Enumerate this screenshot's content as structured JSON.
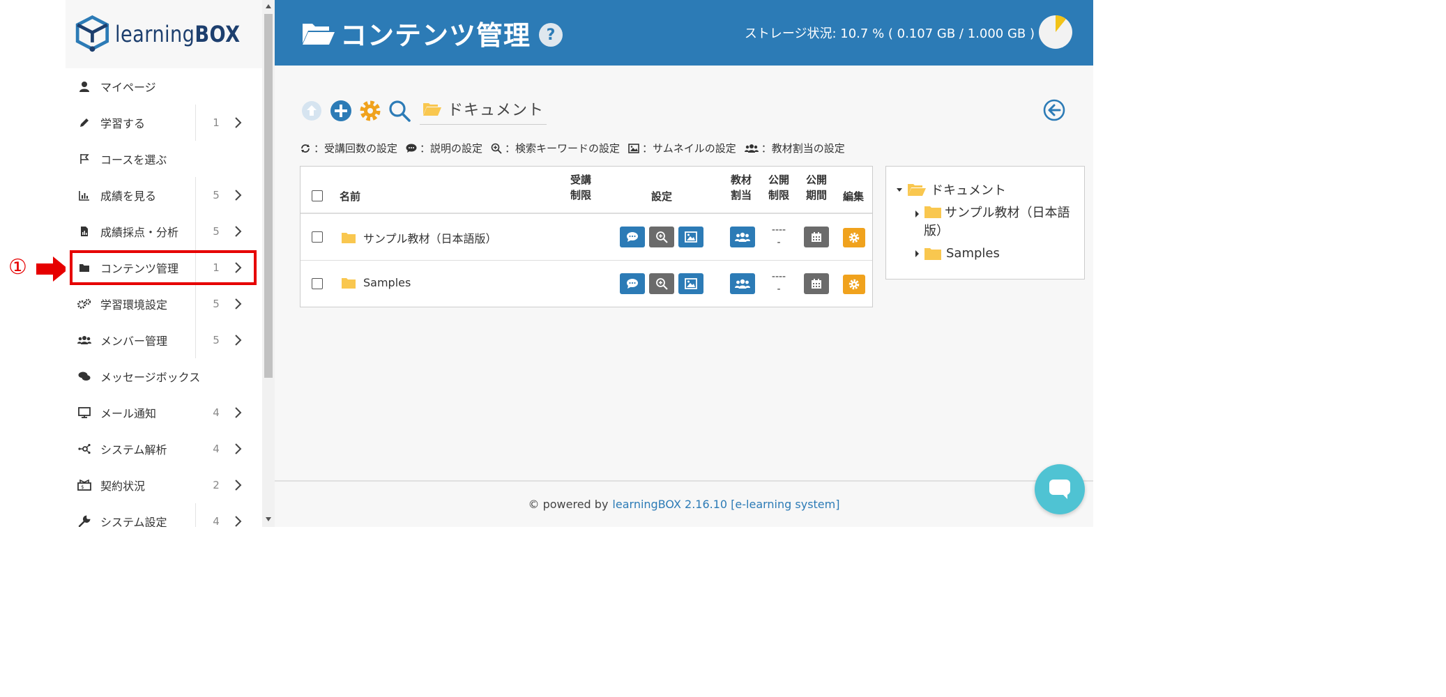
{
  "callout": {
    "number": "①"
  },
  "logo": {
    "brand_light": "learning",
    "brand_bold": "BOX"
  },
  "sidebar": {
    "items": [
      {
        "label": "マイページ",
        "icon": "user-icon",
        "count": "",
        "has_chevron": false
      },
      {
        "label": "学習する",
        "icon": "pencil-icon",
        "count": "1",
        "has_chevron": true
      },
      {
        "label": "コースを選ぶ",
        "icon": "flag-icon",
        "count": "",
        "has_chevron": false
      },
      {
        "label": "成績を見る",
        "icon": "bar-chart-icon",
        "count": "5",
        "has_chevron": true
      },
      {
        "label": "成績採点・分析",
        "icon": "report-icon",
        "count": "5",
        "has_chevron": true
      },
      {
        "label": "コンテンツ管理",
        "icon": "folder-icon",
        "count": "1",
        "has_chevron": true,
        "selected": true
      },
      {
        "label": "学習環境設定",
        "icon": "gears-icon",
        "count": "5",
        "has_chevron": true
      },
      {
        "label": "メンバー管理",
        "icon": "users-icon",
        "count": "5",
        "has_chevron": true
      },
      {
        "label": "メッセージボックス",
        "icon": "comments-icon",
        "count": "",
        "has_chevron": false
      },
      {
        "label": "メール通知",
        "icon": "monitor-icon",
        "count": "4",
        "has_chevron": true
      },
      {
        "label": "システム解析",
        "icon": "network-icon",
        "count": "4",
        "has_chevron": true
      },
      {
        "label": "契約状況",
        "icon": "contract-icon",
        "count": "2",
        "has_chevron": true
      },
      {
        "label": "システム設定",
        "icon": "wrench-icon",
        "count": "4",
        "has_chevron": true
      }
    ]
  },
  "header": {
    "title": "コンテンツ管理",
    "help": "?",
    "storage": "ストレージ状況: 10.7 % ( 0.107 GB / 1.000 GB )",
    "storage_percent": 10.7
  },
  "toolbar": {
    "breadcrumb": "ドキュメント"
  },
  "legend": [
    {
      "icon": "repeat-icon",
      "label": "：受講回数の設定"
    },
    {
      "icon": "comment-icon",
      "label": "：説明の設定"
    },
    {
      "icon": "search-plus-icon",
      "label": "：検索キーワードの設定"
    },
    {
      "icon": "image-icon",
      "label": "：サムネイルの設定"
    },
    {
      "icon": "users-icon",
      "label": "：教材割当の設定"
    }
  ],
  "table": {
    "headers": {
      "name": "名前",
      "limit_1": "受講",
      "limit_2": "制限",
      "settings": "設定",
      "assign_1": "教材",
      "assign_2": "割当",
      "pub_limit_1": "公開",
      "pub_limit_2": "制限",
      "pub_period_1": "公開",
      "pub_period_2": "期間",
      "edit": "編集"
    },
    "rows": [
      {
        "name": "サンプル教材（日本語版）",
        "pub_limit_1": "----",
        "pub_limit_2": "-"
      },
      {
        "name": "Samples",
        "pub_limit_1": "----",
        "pub_limit_2": "-"
      }
    ]
  },
  "tree": {
    "root": "ドキュメント",
    "children": [
      "サンプル教材（日本語版）",
      "Samples"
    ]
  },
  "footer": {
    "prefix": "© powered by",
    "link": "learningBOX 2.16.10 [e-learning system]"
  },
  "colors": {
    "primary": "#2c7bb6",
    "accent": "#f0a21d",
    "highlight": "#e60000",
    "folder": "#f9c74f",
    "chat": "#4fc3d3"
  }
}
